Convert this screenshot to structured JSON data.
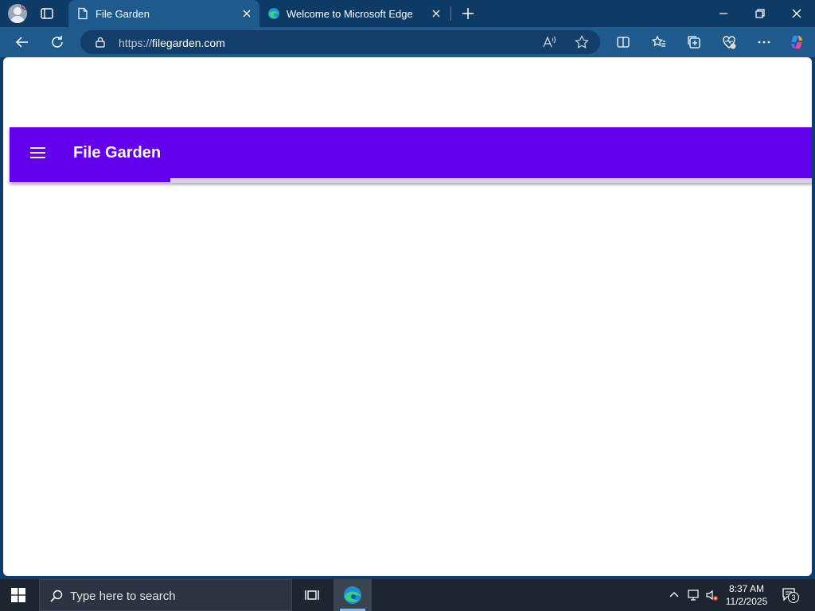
{
  "browser": {
    "tabs": [
      {
        "title": "File Garden",
        "active": true,
        "icon": "page-icon"
      },
      {
        "title": "Welcome to Microsoft Edge",
        "active": false,
        "icon": "edge-icon"
      }
    ],
    "address": {
      "protocol": "https://",
      "host": "filegarden.com"
    }
  },
  "page": {
    "app_title": "File Garden",
    "menu_icon": "hamburger-menu-icon",
    "accent_color": "#6200ee",
    "loading_progress_percent": 20
  },
  "taskbar": {
    "search_placeholder": "Type here to search",
    "time": "8:37 AM",
    "date": "11/2/2025",
    "notification_count": "3"
  }
}
